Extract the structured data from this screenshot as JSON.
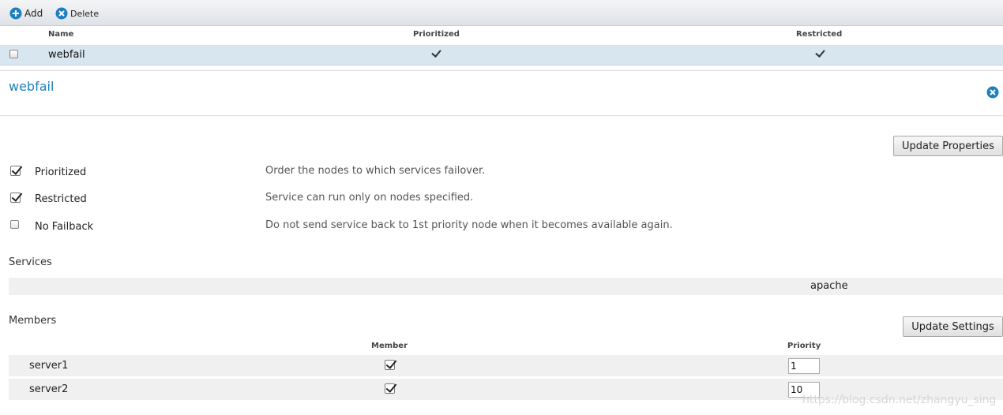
{
  "toolbar": {
    "add_label": "Add",
    "delete_label": "Delete"
  },
  "list": {
    "columns": {
      "name": "Name",
      "prioritized": "Prioritized",
      "restricted": "Restricted"
    },
    "rows": [
      {
        "name": "webfail",
        "prioritized": true,
        "restricted": true,
        "selected": false
      }
    ]
  },
  "detail": {
    "title": "webfail",
    "update_properties_label": "Update Properties",
    "options": [
      {
        "label": "Prioritized",
        "checked": true,
        "description": "Order the nodes to which services failover."
      },
      {
        "label": "Restricted",
        "checked": true,
        "description": "Service can run only on nodes specified."
      },
      {
        "label": "No Failback",
        "checked": false,
        "description": "Do not send service back to 1st priority node when it becomes available again."
      }
    ],
    "services_label": "Services",
    "services": [
      "apache"
    ],
    "members_label": "Members",
    "update_settings_label": "Update Settings",
    "members_columns": {
      "member": "Member",
      "priority": "Priority"
    },
    "members": [
      {
        "name": "server1",
        "member": true,
        "priority": "1"
      },
      {
        "name": "server2",
        "member": true,
        "priority": "10"
      }
    ]
  },
  "watermark": "https://blog.csdn.net/zhangyu_sing",
  "colors": {
    "accent": "#1e82b8",
    "selected_row": "#d8e6f0"
  }
}
